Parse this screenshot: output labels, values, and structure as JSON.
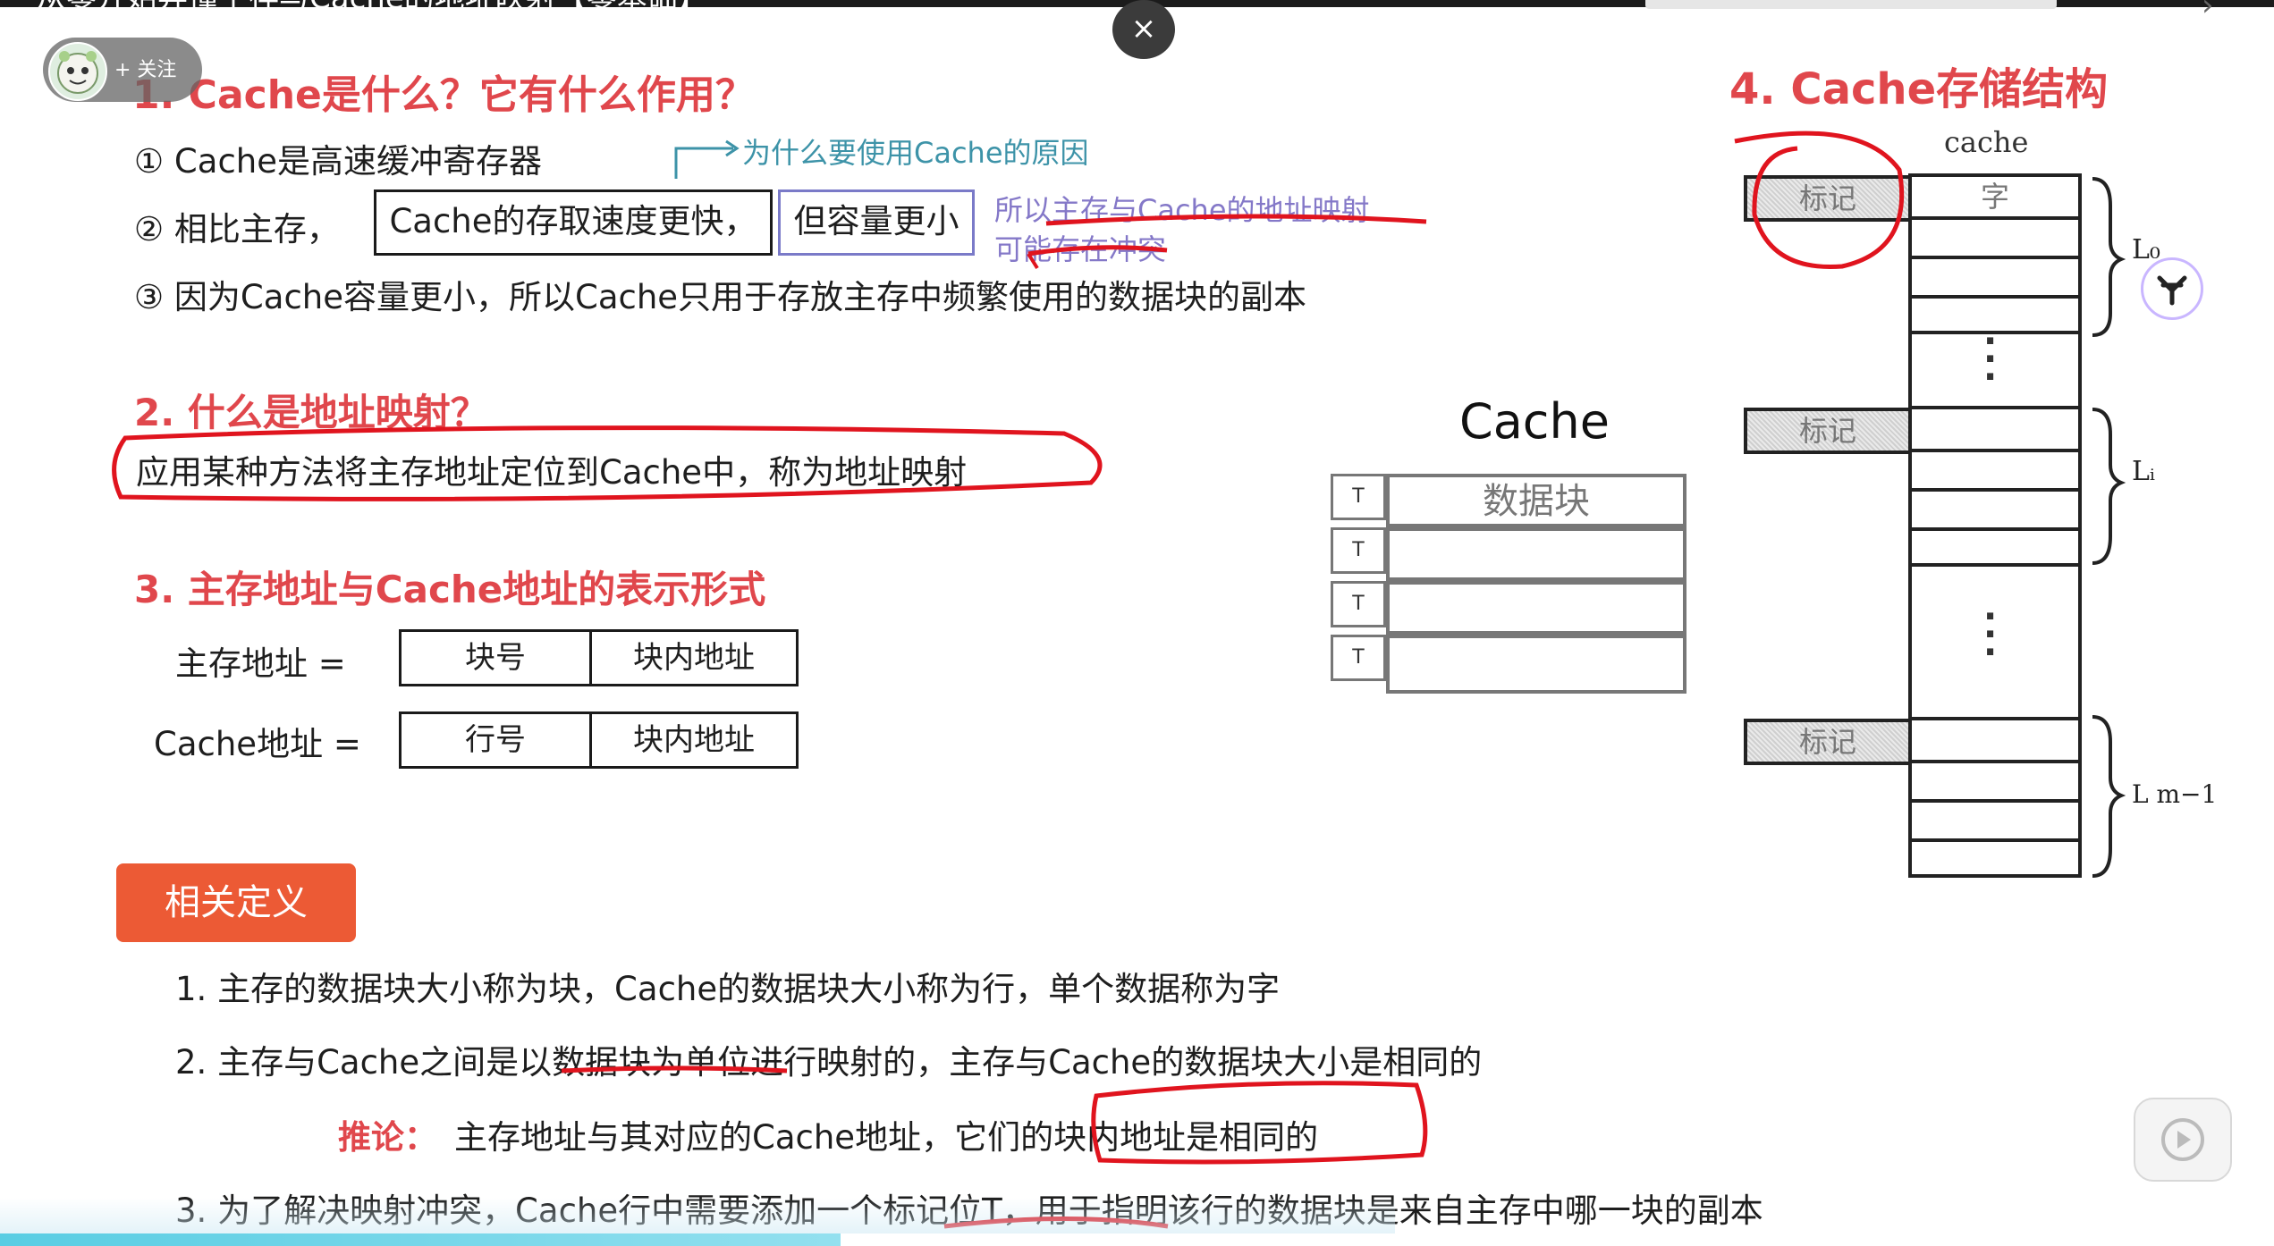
{
  "header": {
    "video_title": "从零开始弄懂主存与Cache的地址映射【零基础】",
    "follow_label": "+ 关注",
    "close_symbol": "×"
  },
  "section1": {
    "heading": "1. Cache是什么？它有什么作用？",
    "item1": "① Cache是高速缓冲寄存器",
    "item2_prefix": "② 相比主存，",
    "item2_box1": "Cache的存取速度更快，",
    "item2_box2": "但容量更小",
    "item3": "③ 因为Cache容量更小，所以Cache只用于存放主存中频繁使用的数据块的副本",
    "note_reason": "为什么要使用Cache的原因",
    "note_conflict_line1": "所以主存与Cache的地址映射",
    "note_conflict_line2": "可能存在冲突"
  },
  "section2": {
    "heading": "2. 什么是地址映射？",
    "definition": "应用某种方法将主存地址定位到Cache中，称为地址映射"
  },
  "section3": {
    "heading": "3. 主存地址与Cache地址的表示形式",
    "main_label": "主存地址 =",
    "main_fields": [
      "块号",
      "块内地址"
    ],
    "cache_label": "Cache地址 =",
    "cache_fields": [
      "行号",
      "块内地址"
    ]
  },
  "cache_diagram": {
    "title": "Cache",
    "tag_label": "T",
    "first_block_label": "数据块",
    "rows": 4
  },
  "section4": {
    "heading": "4. Cache存储结构",
    "column_title": "cache",
    "tag_label": "标记",
    "word_label": "字",
    "group_labels": [
      "L₀",
      "Lᵢ",
      "L m−1"
    ]
  },
  "definitions": {
    "button_label": "相关定义",
    "items": [
      "1.   主存的数据块大小称为块，Cache的数据块大小称为行，单个数据称为字",
      "2.   主存与Cache之间是以数据块为单位进行映射的，主存与Cache的数据块大小是相同的",
      "3.   为了解决映射冲突，Cache行中需要添加一个标记位T，用于指明该行的数据块是来自主存中哪一块的副本"
    ],
    "inference_label": "推论：",
    "inference_text": "主存地址与其对应的Cache地址，它们的块内地址是相同的"
  },
  "colors": {
    "heading_red": "#e0474c",
    "button_orange": "#ec5a35",
    "note_blue": "#3d93a8",
    "note_purple": "#8478c8",
    "ink_red": "#e0141e"
  },
  "icons": [
    "avatar-icon",
    "close-icon",
    "side-tool-icon",
    "play-icon"
  ]
}
